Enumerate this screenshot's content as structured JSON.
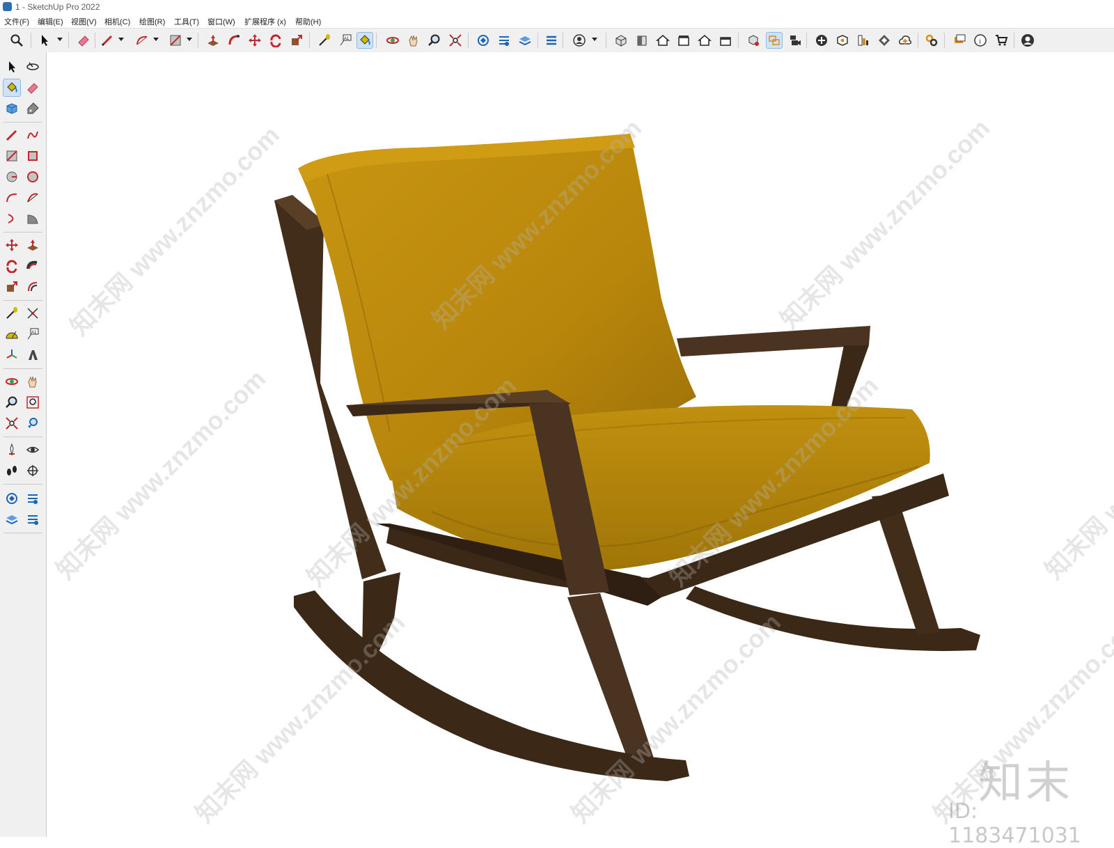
{
  "window": {
    "title": "1 - SketchUp Pro 2022"
  },
  "menu": [
    {
      "label": "文件(F)"
    },
    {
      "label": "编辑(E)"
    },
    {
      "label": "视图(V)"
    },
    {
      "label": "相机(C)"
    },
    {
      "label": "绘图(R)"
    },
    {
      "label": "工具(T)"
    },
    {
      "label": "窗口(W)"
    },
    {
      "label": "扩展程序 (x)"
    },
    {
      "label": "帮助(H)"
    }
  ],
  "toolbar": {
    "tools": [
      "zoom-extents-icon",
      "select-icon",
      "eraser-icon",
      "pencil-icon",
      "arc-icon",
      "rectangle-icon",
      "push-pull-icon",
      "follow-me-icon",
      "move-icon",
      "rotate-icon",
      "scale-icon",
      "tape-measure-icon",
      "text-icon",
      "paint-bucket-icon",
      "orbit-icon",
      "pan-icon",
      "zoom-icon",
      "zoom-window-icon",
      "warehouse-icon",
      "layers-icon",
      "outliner-icon",
      "components-icon",
      "user-icon",
      "iso-view-icon",
      "front-view-icon",
      "home-view-icon",
      "top-view-icon",
      "right-view-icon",
      "back-view-icon",
      "style-icon",
      "section-icon",
      "camera-icon",
      "add-icon",
      "location-icon",
      "report-icon",
      "pattern-icon",
      "upload-icon",
      "settings-icon",
      "chat-icon",
      "info-icon",
      "cart-icon",
      "account-icon"
    ]
  },
  "left_tools": [
    "select-icon",
    "orbit-icon",
    "paint-bucket-icon",
    "eraser-icon",
    "components-icon",
    "tag-icon",
    "pencil-icon",
    "freehand-icon",
    "rectangle-icon",
    "rotated-rectangle-icon",
    "circle-icon",
    "polygon-icon",
    "arc-icon",
    "pie-icon",
    "two-point-arc-icon",
    "three-point-arc-icon",
    "move-icon",
    "push-pull-icon",
    "rotate-icon",
    "follow-me-icon",
    "scale-icon",
    "offset-icon",
    "tape-measure-icon",
    "dimension-icon",
    "protractor-icon",
    "text-icon",
    "axes-icon",
    "3d-text-icon",
    "orbit-icon",
    "pan-icon",
    "zoom-icon",
    "zoom-window-icon",
    "zoom-extents-icon",
    "previous-view-icon",
    "position-camera-icon",
    "look-around-icon",
    "walk-icon",
    "section-plane-icon",
    "warehouse-icon",
    "extension-warehouse-icon",
    "layout-icon",
    "share-icon"
  ],
  "watermark": {
    "site": "知末网 www.znzmo.com",
    "logo": "知末",
    "id": "ID: 1183471031"
  },
  "colors": {
    "cushion": "#b8860b",
    "cushion_shadow": "#8a6408",
    "wood": "#4a3320",
    "wood_dark": "#2e1f12",
    "ui_bg": "#f0f0f0",
    "active_bg": "#cfe3f7"
  }
}
